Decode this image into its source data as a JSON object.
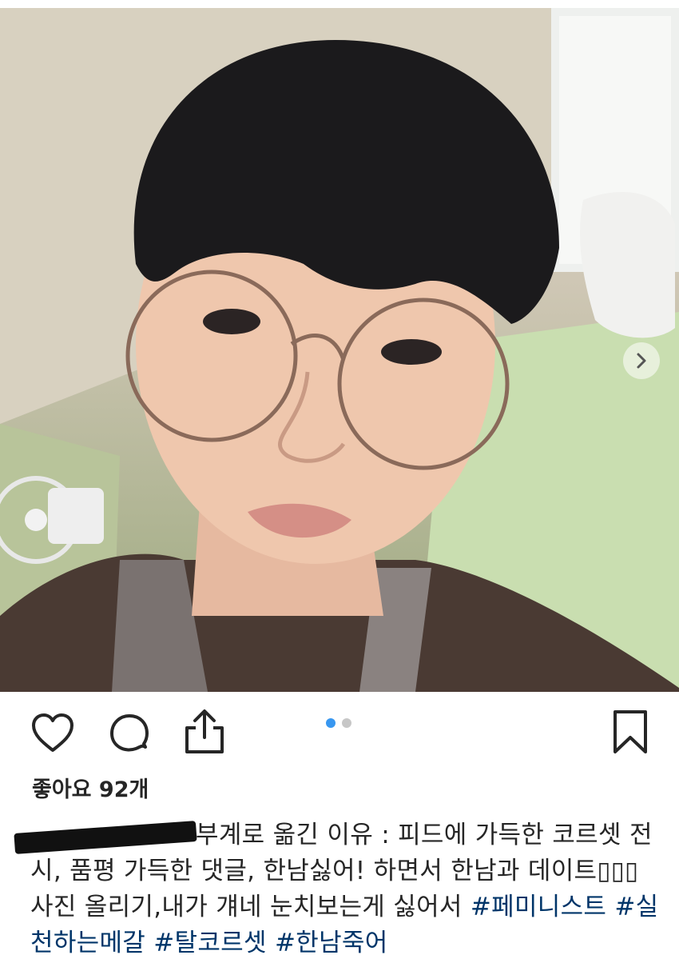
{
  "post": {
    "photo": {
      "description_icon": "selfie-photo",
      "next_icon": "chevron-right-icon"
    },
    "carousel": {
      "count": 2,
      "active_index": 0,
      "active_color": "#3897f0",
      "inactive_color": "#c7c7c7"
    },
    "actions": {
      "like_icon": "heart-icon",
      "comment_icon": "comment-icon",
      "share_icon": "share-icon",
      "save_icon": "bookmark-icon"
    },
    "likes_text": "좋아요 92개",
    "caption": {
      "text": "부계로 옮긴 이유 : 피드에 가득한 코르셋 전시, 품평 가득한 댓글, 한남싫어! 하면서 한남과 데이트▯▯▯사진 올리기,내가 걔네 눈치보는게 싫어서",
      "hashtags": [
        "#페미니스트",
        "#실천하는메갈",
        "#탈코르셋",
        "#한남죽어"
      ],
      "hashtag_color": "#003569"
    }
  }
}
